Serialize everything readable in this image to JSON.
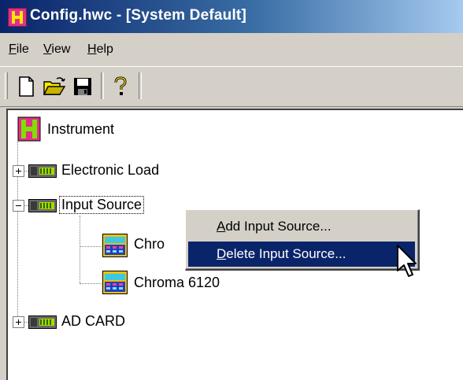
{
  "window": {
    "title": "Config.hwc - [System Default]",
    "icon": "app-icon"
  },
  "menubar": {
    "items": [
      {
        "label": "File",
        "mnemonic": "F",
        "rest": "ile"
      },
      {
        "label": "View",
        "mnemonic": "V",
        "rest": "iew"
      },
      {
        "label": "Help",
        "mnemonic": "H",
        "rest": "elp"
      }
    ]
  },
  "toolbar": {
    "buttons": [
      {
        "icon": "new-document-icon"
      },
      {
        "icon": "open-folder-icon"
      },
      {
        "icon": "save-icon"
      },
      {
        "icon": "help-icon"
      }
    ]
  },
  "tree": {
    "root": {
      "label": "Instrument",
      "icon": "instrument-root-icon"
    },
    "nodes": [
      {
        "label": "Electronic Load",
        "expanded": false,
        "icon": "device-rack-icon"
      },
      {
        "label": "Input Source",
        "expanded": true,
        "selected": true,
        "icon": "device-rack-icon",
        "children": [
          {
            "label": "Chro",
            "icon": "chroma-device-icon"
          },
          {
            "label": "Chroma 6120",
            "icon": "chroma-device-icon"
          }
        ]
      },
      {
        "label": "AD CARD",
        "expanded": false,
        "icon": "device-rack-icon"
      }
    ]
  },
  "context_menu": {
    "items": [
      {
        "label": "Add Input Source...",
        "mnemonic": "A",
        "rest": "dd Input Source...",
        "highlighted": false
      },
      {
        "label": "Delete Input Source...",
        "mnemonic": "D",
        "rest": "elete Input Source...",
        "highlighted": true
      }
    ]
  },
  "colors": {
    "title_bar_start": "#0a246a",
    "title_bar_end": "#a6caf0",
    "face": "#d4d0c8",
    "highlight": "#0a246a"
  }
}
